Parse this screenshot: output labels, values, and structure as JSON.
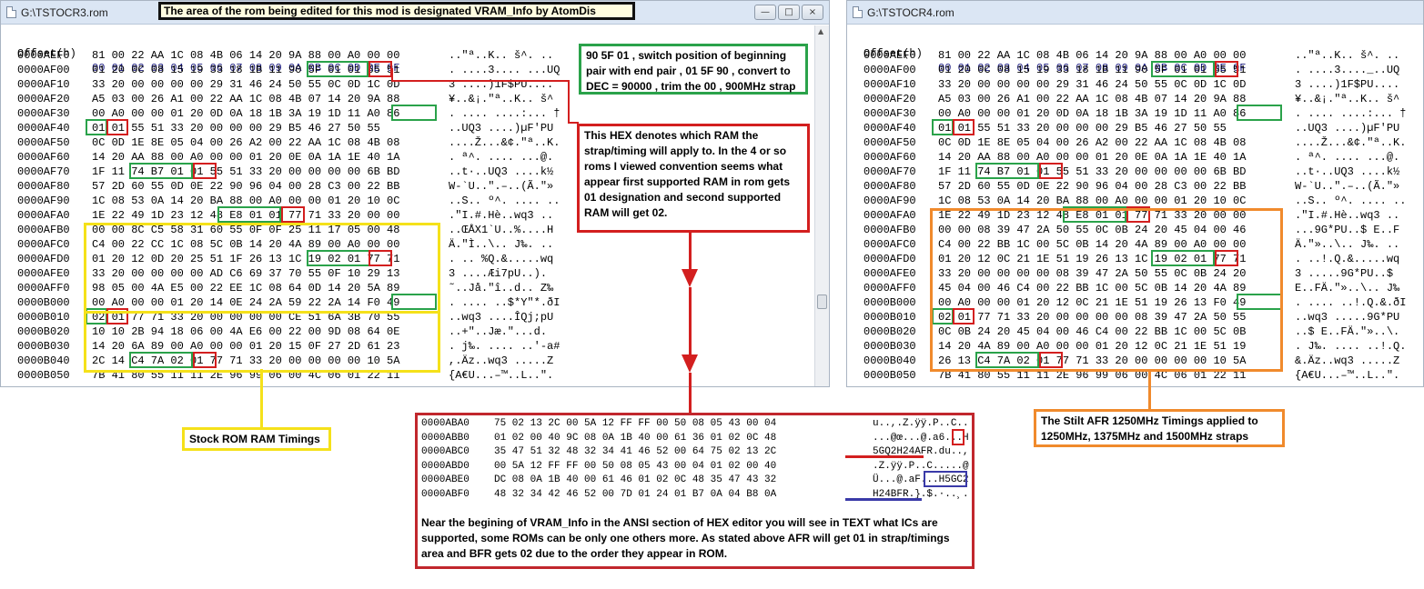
{
  "banner": "The area of the rom being edited for this mod is designated VRAM_Info by AtomDis",
  "left_window": {
    "title": "G:\\TSTOCR3.rom",
    "header_offset": "Offset(h)",
    "header_cols": "00 01 02 03 04 05 06 07 08 09 0A 0B 0C 0D 0E 0F",
    "rows": [
      {
        "off": "0000AEF0",
        "hex": "81 00 22 AA 1C 08 4B 06 14 20 9A 88 00 A0 00 00",
        "asc": "..\"ª..K.. š^. .."
      },
      {
        "off": "0000AF00",
        "hex": "01 20 0C 08 15 19 33 18 1B 11 90 5F 01 01 55 51",
        "asc": ". ....3.... ...UQ"
      },
      {
        "off": "0000AF10",
        "hex": "33 20 00 00 00 00 29 31 46 24 50 55 0C 0D 1C 0D",
        "asc": "3 ....)1F$PU...."
      },
      {
        "off": "0000AF20",
        "hex": "A5 03 00 26 A1 00 22 AA 1C 08 4B 07 14 20 9A 88",
        "asc": "¥..&¡.\"ª..K.. š^"
      },
      {
        "off": "0000AF30",
        "hex": "00 A0 00 00 01 20 0D 0A 18 1B 3A 19 1D 11 A0 86",
        "asc": ". .... ....:... †"
      },
      {
        "off": "0000AF40",
        "hex": "01 01 55 51 33 20 00 00 00 29 B5 46 27 50 55",
        "asc": "..UQ3 ....)µF'PU"
      },
      {
        "off": "0000AF50",
        "hex": "0C 0D 1E 8E 05 04 00 26 A2 00 22 AA 1C 08 4B 08",
        "asc": "....Ž...&¢.\"ª..K."
      },
      {
        "off": "0000AF60",
        "hex": "14 20 AA 88 00 A0 00 00 01 20 0E 0A 1A 1E 40 1A",
        "asc": ". ª^. .... ...@."
      },
      {
        "off": "0000AF70",
        "hex": "1F 11 74 B7 01 01 55 51 33 20 00 00 00 00 6B BD",
        "asc": "..t·..UQ3 ....k½"
      },
      {
        "off": "0000AF80",
        "hex": "57 2D 60 55 0D 0E 22 90 96 04 00 28 C3 00 22 BB",
        "asc": "W-`U..\".–..(Ã.\"»"
      },
      {
        "off": "0000AF90",
        "hex": "1C 08 53 0A 14 20 BA 88 00 A0 00 00 01 20 10 0C",
        "asc": "..S.. º^. .... .."
      },
      {
        "off": "0000AFA0",
        "hex": "1E 22 49 1D 23 12 48 E8 01 01 77 71 33 20 00 00",
        "asc": ".\"I.#.Hè..wq3 .."
      },
      {
        "off": "0000AFB0",
        "hex": "00 00 8C C5 58 31 60 55 0F 0F 25 11 17 05 00 48",
        "asc": "..ŒÅX1`U..%....H"
      },
      {
        "off": "0000AFC0",
        "hex": "C4 00 22 CC 1C 08 5C 0B 14 20 4A 89 00 A0 00 00",
        "asc": "Ä.\"Ì..\\.. J‰. .."
      },
      {
        "off": "0000AFD0",
        "hex": "01 20 12 0D 20 25 51 1F 26 13 1C 19 02 01 77 71",
        "asc": ". .. %Q.&.....wq"
      },
      {
        "off": "0000AFE0",
        "hex": "33 20 00 00 00 00 AD C6 69 37 70 55 0F 10 29 13",
        "asc": "3 ....­Æi7pU..)."
      },
      {
        "off": "0000AFF0",
        "hex": "98 05 00 4A E5 00 22 EE 1C 08 64 0D 14 20 5A 89",
        "asc": "˜..Jå.\"î..d.. Z‰"
      },
      {
        "off": "0000B000",
        "hex": "00 A0 00 00 01 20 14 0E 24 2A 59 22 2A 14 F0 49",
        "asc": ". .... ..$*Y\"*.ðI"
      },
      {
        "off": "0000B010",
        "hex": "02 01 77 71 33 20 00 00 00 00 CE 51 6A 3B 70 55",
        "asc": "..wq3 ....ÎQj;pU"
      },
      {
        "off": "0000B020",
        "hex": "10 10 2B 94 18 06 00 4A E6 00 22 00 9D 08 64 0E",
        "asc": "..+\"..Jæ.\"...d."
      },
      {
        "off": "0000B030",
        "hex": "14 20 6A 89 00 A0 00 00 01 20 15 0F 27 2D 61 23",
        "asc": ". j‰. .... ..'-a#"
      },
      {
        "off": "0000B040",
        "hex": "2C 14 C4 7A 02 01 77 71 33 20 00 00 00 00 10 5A",
        "asc": ",.Äz..wq3 .....Z"
      },
      {
        "off": "0000B050",
        "hex": "7B 41 80 55 11 11 2E 96 99 06 00 4C 06 01 22 11",
        "asc": "{A€U...–™..L..\"."
      }
    ]
  },
  "right_window": {
    "title": "G:\\TSTOCR4.rom",
    "header_offset": "Offset(h)",
    "header_cols": "00 01 02 03 04 05 06 07 08 09 0A 0B 0C 0D 0E 0F",
    "rows": [
      {
        "off": "0000AEF0",
        "hex": "81 00 22 AA 1C 08 4B 06 14 20 9A 88 00 A0 00 00",
        "asc": "..\"ª..K.. š^. .."
      },
      {
        "off": "0000AF00",
        "hex": "01 20 0C 08 15 19 33 18 1B 11 90 5F 01 01 55 51",
        "asc": ". ....3...._..UQ"
      },
      {
        "off": "0000AF10",
        "hex": "33 20 00 00 00 00 29 31 46 24 50 55 0C 0D 1C 0D",
        "asc": "3 ....)1F$PU...."
      },
      {
        "off": "0000AF20",
        "hex": "A5 03 00 26 A1 00 22 AA 1C 08 4B 07 14 20 9A 88",
        "asc": "¥..&¡.\"ª..K.. š^"
      },
      {
        "off": "0000AF30",
        "hex": "00 A0 00 00 01 20 0D 0A 18 1B 3A 19 1D 11 A0 86",
        "asc": ". .... ....:... †"
      },
      {
        "off": "0000AF40",
        "hex": "01 01 55 51 33 20 00 00 00 29 B5 46 27 50 55",
        "asc": "..UQ3 ....)µF'PU"
      },
      {
        "off": "0000AF50",
        "hex": "0C 0D 1E 8E 05 04 00 26 A2 00 22 AA 1C 08 4B 08",
        "asc": "....Ž...&¢.\"ª..K."
      },
      {
        "off": "0000AF60",
        "hex": "14 20 AA 88 00 A0 00 00 01 20 0E 0A 1A 1E 40 1A",
        "asc": ". ª^. .... ...@."
      },
      {
        "off": "0000AF70",
        "hex": "1F 11 74 B7 01 01 55 51 33 20 00 00 00 00 6B BD",
        "asc": "..t·..UQ3 ....k½"
      },
      {
        "off": "0000AF80",
        "hex": "57 2D 60 55 0D 0E 22 90 96 04 00 28 C3 00 22 BB",
        "asc": "W-`U..\".–..(Ã.\"»"
      },
      {
        "off": "0000AF90",
        "hex": "1C 08 53 0A 14 20 BA 88 00 A0 00 00 01 20 10 0C",
        "asc": "..S.. º^. .... .."
      },
      {
        "off": "0000AFA0",
        "hex": "1E 22 49 1D 23 12 48 E8 01 01 77 71 33 20 00 00",
        "asc": ".\"I.#.Hè..wq3 .."
      },
      {
        "off": "0000AFB0",
        "hex": "00 00 08 39 47 2A 50 55 0C 0B 24 20 45 04 00 46",
        "asc": "...9G*PU..$ E..F"
      },
      {
        "off": "0000AFC0",
        "hex": "C4 00 22 BB 1C 00 5C 0B 14 20 4A 89 00 A0 00 00",
        "asc": "Ä.\"»..\\.. J‰. .."
      },
      {
        "off": "0000AFD0",
        "hex": "01 20 12 0C 21 1E 51 19 26 13 1C 19 02 01 77 71",
        "asc": ". ..!.Q.&.....wq"
      },
      {
        "off": "0000AFE0",
        "hex": "33 20 00 00 00 00 08 39 47 2A 50 55 0C 0B 24 20",
        "asc": "3 .....9G*PU..$ "
      },
      {
        "off": "0000AFF0",
        "hex": "45 04 00 46 C4 00 22 BB 1C 00 5C 0B 14 20 4A 89",
        "asc": "E..FÄ.\"»..\\.. J‰"
      },
      {
        "off": "0000B000",
        "hex": "00 A0 00 00 01 20 12 0C 21 1E 51 19 26 13 F0 49",
        "asc": ". .... ..!.Q.&.ðI"
      },
      {
        "off": "0000B010",
        "hex": "02 01 77 71 33 20 00 00 00 00 08 39 47 2A 50 55",
        "asc": "..wq3 .....9G*PU"
      },
      {
        "off": "0000B020",
        "hex": "0C 0B 24 20 45 04 00 46 C4 00 22 BB 1C 00 5C 0B",
        "asc": "..$ E..FÄ.\"»..\\."
      },
      {
        "off": "0000B030",
        "hex": "14 20 4A 89 00 A0 00 00 01 20 12 0C 21 1E 51 19",
        "asc": ". J‰. .... ..!.Q."
      },
      {
        "off": "0000B040",
        "hex": "26 13 C4 7A 02 01 77 71 33 20 00 00 00 00 10 5A",
        "asc": "&.Äz..wq3 .....Z"
      },
      {
        "off": "0000B050",
        "hex": "7B 41 80 55 11 11 2E 96 99 06 00 4C 06 01 22 11",
        "asc": "{A€U...–™..L..\"."
      }
    ]
  },
  "annotations": {
    "strap_note": "90 5F 01 , switch position of beginning pair with end pair , 01 5F 90 , convert to DEC = 90000 , trim the 00 , 900MHz strap",
    "ram_note": "This HEX denotes which RAM the strap/timing will apply to. In the 4 or so roms I viewed convention seems what appear first supported RAM in rom gets 01 designation and second supported RAM will get 02.",
    "stock_label": "Stock ROM RAM Timings",
    "stilt_label": "The Stilt  AFR 1250MHz Timings applied to 1250MHz, 1375MHz and 1500MHz straps"
  },
  "inset": {
    "rows": [
      {
        "off": "0000ABA0",
        "hex": "75 02 13 2C 00 5A 12 FF FF 00 50 08 05 43 00 04",
        "asc": "u..,.Z.ÿÿ.P..C.."
      },
      {
        "off": "0000ABB0",
        "hex": "01 02 00 40 9C 08 0A 1B 40 00 61 36 01 02 0C 48",
        "asc": "...@œ...@.a6...H"
      },
      {
        "off": "0000ABC0",
        "hex": "35 47 51 32 48 32 34 41 46 52 00 64 75 02 13 2C",
        "asc": "5GQ2H24AFR.du..,"
      },
      {
        "off": "0000ABD0",
        "hex": "00 5A 12 FF FF 00 50 08 05 43 00 04 01 02 00 40",
        "asc": ".Z.ÿÿ.P..C.....@"
      },
      {
        "off": "0000ABE0",
        "hex": "DC 08 0A 1B 40 00 61 46 01 02 0C 48 35 47 43 32",
        "asc": "Ü...@.aF...H5GC2"
      },
      {
        "off": "0000ABF0",
        "hex": "48 32 34 42 46 52 00 7D 01 24 01 B7 0A 04 B8 0A",
        "asc": "H24BFR.}.$.·..¸."
      }
    ],
    "note": "Near the begining of VRAM_Info in the ANSI section of HEX editor you will see in TEXT what ICs are supported, some ROMs can be only one others more. As stated above AFR will get 01 in strap/timings area and BFR gets 02 due to the order they appear in ROM."
  },
  "colors": {
    "strap_box": "#2aa24a",
    "ram_id_box": "#d31f1f",
    "stock_timings": "#f5e11a",
    "stilt_timings": "#f08a2c",
    "afr_underline": "#d31f1f",
    "bfr_underline": "#3a3aa8"
  }
}
